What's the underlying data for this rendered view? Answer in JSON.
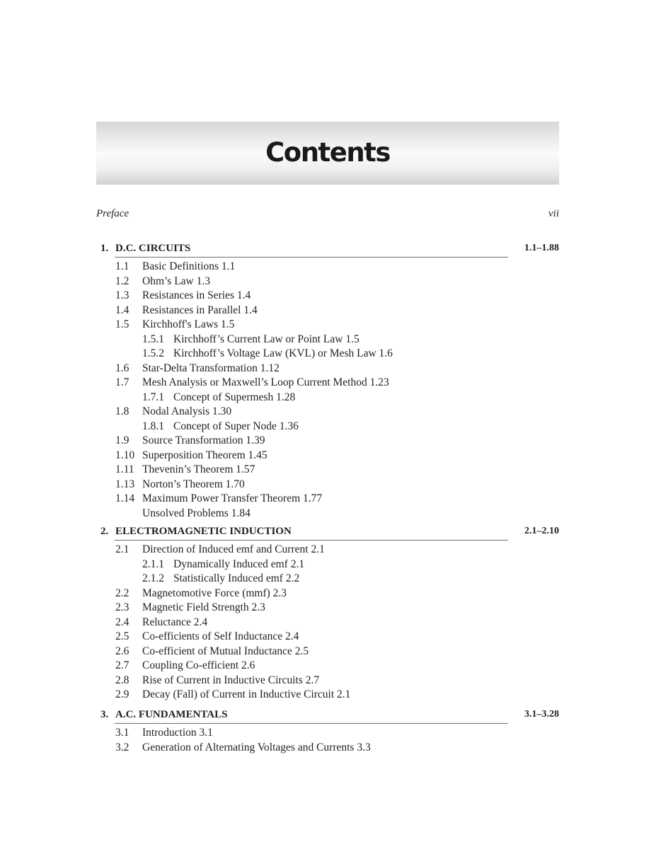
{
  "heading": "Contents",
  "preface": {
    "label": "Preface",
    "page": "vii"
  },
  "chapters": [
    {
      "number": "1.",
      "title": "D.C. CIRCUITS",
      "pages": "1.1–1.88",
      "entries": [
        {
          "num": "1.1",
          "text": "Basic Definitions  1.1",
          "level": 1
        },
        {
          "num": "1.2",
          "text": "Ohm’s Law  1.3",
          "level": 1
        },
        {
          "num": "1.3",
          "text": "Resistances in Series  1.4",
          "level": 1
        },
        {
          "num": "1.4",
          "text": "Resistances in Parallel  1.4",
          "level": 1
        },
        {
          "num": "1.5",
          "text": "Kirchhoff's Laws  1.5",
          "level": 1
        },
        {
          "num": "1.5.1",
          "text": "Kirchhoff’s Current Law or Point Law  1.5",
          "level": 2
        },
        {
          "num": "1.5.2",
          "text": "Kirchhoff’s Voltage Law (KVL) or Mesh Law  1.6",
          "level": 2
        },
        {
          "num": "1.6",
          "text": "Star-Delta Transformation 1.12",
          "level": 1
        },
        {
          "num": "1.7",
          "text": "Mesh Analysis or Maxwell’s Loop Current Method  1.23",
          "level": 1
        },
        {
          "num": "1.7.1",
          "text": "Concept of Supermesh  1.28",
          "level": 2
        },
        {
          "num": "1.8",
          "text": "Nodal Analysis  1.30",
          "level": 1
        },
        {
          "num": "1.8.1",
          "text": "Concept of Super Node  1.36",
          "level": 2
        },
        {
          "num": "1.9",
          "text": "Source Transformation  1.39",
          "level": 1
        },
        {
          "num": "1.10",
          "text": "Superposition Theorem  1.45",
          "level": 1
        },
        {
          "num": "1.11",
          "text": "Thevenin’s Theorem  1.57",
          "level": 1
        },
        {
          "num": "1.13",
          "text": "Norton’s Theorem  1.70",
          "level": 1
        },
        {
          "num": "1.14",
          "text": "Maximum Power Transfer Theorem  1.77",
          "level": 1
        },
        {
          "num": "",
          "text": "Unsolved Problems  1.84",
          "level": 1
        }
      ]
    },
    {
      "number": "2.",
      "title": "ELECTROMAGNETIC INDUCTION",
      "pages": "2.1–2.10",
      "entries": [
        {
          "num": "2.1",
          "text": "Direction of Induced emf and Current  2.1",
          "level": 1
        },
        {
          "num": "2.1.1",
          "text": "Dynamically Induced emf  2.1",
          "level": 2
        },
        {
          "num": "2.1.2",
          "text": "Statistically Induced emf  2.2",
          "level": 2
        },
        {
          "num": "2.2",
          "text": "Magnetomotive Force (mmf)  2.3",
          "level": 1
        },
        {
          "num": "2.3",
          "text": "Magnetic Field Strength  2.3",
          "level": 1
        },
        {
          "num": "2.4",
          "text": "Reluctance  2.4",
          "level": 1
        },
        {
          "num": "2.5",
          "text": "Co-efficients of Self Inductance  2.4",
          "level": 1
        },
        {
          "num": "2.6",
          "text": "Co-efficient of Mutual Inductance  2.5",
          "level": 1
        },
        {
          "num": "2.7",
          "text": "Coupling Co-efficient  2.6",
          "level": 1
        },
        {
          "num": "2.8",
          "text": "Rise of Current in Inductive Circuits  2.7",
          "level": 1
        },
        {
          "num": "2.9",
          "text": "Decay (Fall) of Current in Inductive Circuit  2.1",
          "level": 1
        }
      ]
    },
    {
      "number": "3.",
      "title": "A.C. FUNDAMENTALS",
      "pages": "3.1–3.28",
      "entries": [
        {
          "num": "3.1",
          "text": "Introduction  3.1",
          "level": 1
        },
        {
          "num": "3.2",
          "text": "Generation of Alternating Voltages and Currents  3.3",
          "level": 1
        }
      ]
    }
  ]
}
